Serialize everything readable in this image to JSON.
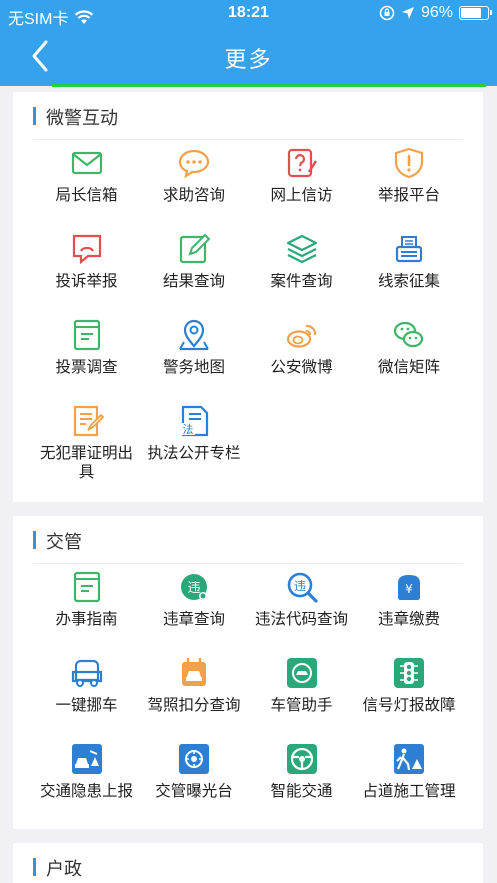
{
  "status_bar": {
    "carrier": "无SIM卡",
    "time": "18:21",
    "battery": "96%"
  },
  "header": {
    "title": "更多"
  },
  "sections": [
    {
      "title": "微警互动",
      "items": [
        {
          "label": "局长信箱",
          "icon": "mail-icon"
        },
        {
          "label": "求助咨询",
          "icon": "chat-bubble-icon"
        },
        {
          "label": "网上信访",
          "icon": "question-doc-icon"
        },
        {
          "label": "举报平台",
          "icon": "shield-alert-icon"
        },
        {
          "label": "投诉举报",
          "icon": "complaint-icon"
        },
        {
          "label": "结果查询",
          "icon": "edit-icon"
        },
        {
          "label": "案件查询",
          "icon": "layers-icon"
        },
        {
          "label": "线索征集",
          "icon": "printer-icon"
        },
        {
          "label": "投票调查",
          "icon": "document-icon"
        },
        {
          "label": "警务地图",
          "icon": "map-pin-icon"
        },
        {
          "label": "公安微博",
          "icon": "weibo-icon"
        },
        {
          "label": "微信矩阵",
          "icon": "wechat-icon"
        },
        {
          "label": "无犯罪证明出具",
          "icon": "certificate-icon"
        },
        {
          "label": "执法公开专栏",
          "icon": "law-doc-icon",
          "badge": "法"
        }
      ]
    },
    {
      "title": "交管",
      "items": [
        {
          "label": "办事指南",
          "icon": "guide-icon"
        },
        {
          "label": "违章查询",
          "icon": "violation-query-icon",
          "badge": "违"
        },
        {
          "label": "违法代码查询",
          "icon": "violation-code-icon",
          "badge": "违"
        },
        {
          "label": "违章缴费",
          "icon": "payment-icon",
          "badge": "¥"
        },
        {
          "label": "一键挪车",
          "icon": "car-icon"
        },
        {
          "label": "驾照扣分查询",
          "icon": "license-points-icon"
        },
        {
          "label": "车管助手",
          "icon": "vehicle-assistant-icon"
        },
        {
          "label": "信号灯报故障",
          "icon": "traffic-light-icon"
        },
        {
          "label": "交通隐患上报",
          "icon": "traffic-hazard-icon"
        },
        {
          "label": "交管曝光台",
          "icon": "exposure-icon"
        },
        {
          "label": "智能交通",
          "icon": "steering-wheel-icon"
        },
        {
          "label": "占道施工管理",
          "icon": "road-work-icon"
        }
      ]
    },
    {
      "title": "户政",
      "items": []
    }
  ],
  "colors": {
    "header_blue": "#35a2ed",
    "accent_green": "#2ecc40",
    "section_bar": "#3a8fd8",
    "icon_green": "#3fb56a",
    "icon_orange": "#f0a24a",
    "icon_red": "#e05050",
    "icon_blue": "#2d7fd3",
    "icon_teal": "#2aa879"
  }
}
